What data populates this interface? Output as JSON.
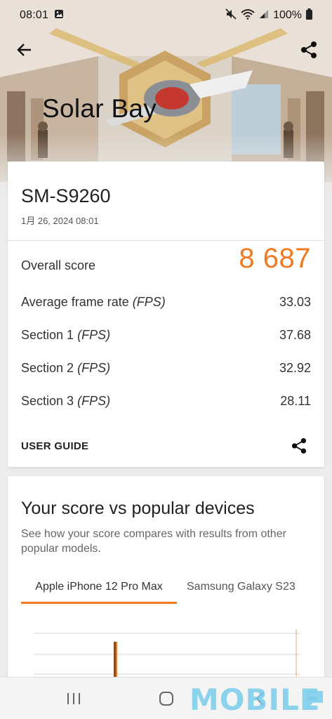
{
  "status_bar": {
    "time": "08:01",
    "battery": "100%",
    "icons": [
      "image-icon",
      "mute-icon",
      "wifi-icon",
      "signal-icon",
      "battery-icon"
    ]
  },
  "app_bar": {
    "back_icon": "arrow-left-icon",
    "share_icon": "share-icon",
    "title": "Solar Bay"
  },
  "result": {
    "device": "SM-S9260",
    "timestamp": "1月 26, 2024 08:01",
    "overall_label": "Overall score",
    "overall_value": "8 687",
    "metrics": [
      {
        "label": "Average frame rate",
        "unit": "(FPS)",
        "value": "33.03"
      },
      {
        "label": "Section 1",
        "unit": "(FPS)",
        "value": "37.68"
      },
      {
        "label": "Section 2",
        "unit": "(FPS)",
        "value": "32.92"
      },
      {
        "label": "Section 3",
        "unit": "(FPS)",
        "value": "28.11"
      }
    ],
    "user_guide": "USER GUIDE"
  },
  "compare": {
    "title": "Your score vs popular devices",
    "description": "See how your score compares with results from other popular models.",
    "tabs": [
      "Apple iPhone 12 Pro Max",
      "Samsung Galaxy S23"
    ],
    "active_tab": 0
  },
  "nav_bar": {
    "icons": [
      "recents-icon",
      "home-icon",
      "back-icon"
    ]
  },
  "watermark": "MOBILE",
  "colors": {
    "accent": "#f07a22",
    "card": "#ffffff",
    "background": "#ececec",
    "watermark": "#78cdeb"
  }
}
